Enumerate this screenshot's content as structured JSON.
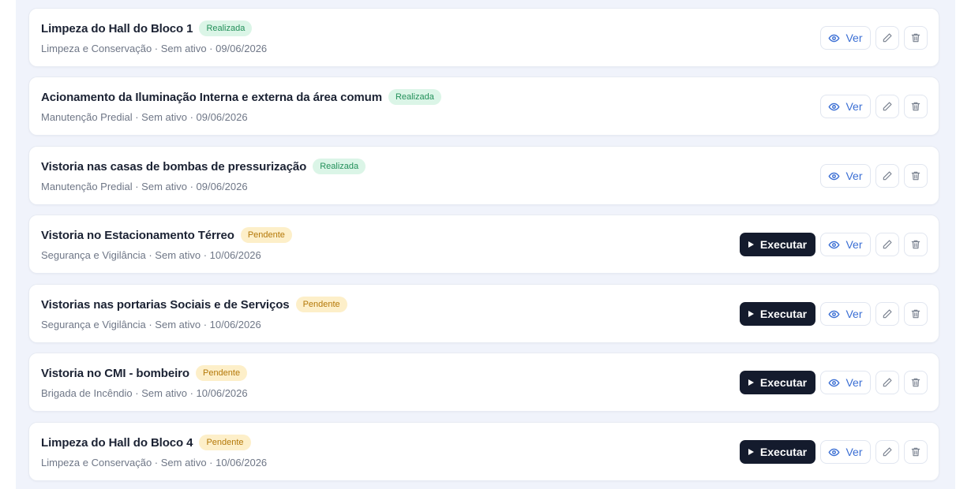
{
  "colors": {
    "background": "#f0f3fb",
    "card": "#ffffff",
    "done_badge_bg": "#dbf5e7",
    "done_badge_text": "#23905a",
    "pending_badge_bg": "#fdefc9",
    "pending_badge_text": "#b47808",
    "execute_button": "#141b2d",
    "link_blue": "#3b6fd4"
  },
  "icons": {
    "execute": "play-icon",
    "view": "eye-icon",
    "edit": "pencil-icon",
    "delete": "trash-icon"
  },
  "labels": {
    "execute": "Executar",
    "view": "Ver"
  },
  "tasks": [
    {
      "title": "Limpeza do Hall do Bloco 1",
      "status": "Realizada",
      "status_type": "done",
      "meta": "Limpeza e Conservação · Sem ativo · 09/06/2026",
      "can_execute": false
    },
    {
      "title": "Acionamento da Iluminação Interna e externa da área comum",
      "status": "Realizada",
      "status_type": "done",
      "meta": "Manutenção Predial · Sem ativo · 09/06/2026",
      "can_execute": false
    },
    {
      "title": "Vistoria nas casas de bombas de pressurização",
      "status": "Realizada",
      "status_type": "done",
      "meta": "Manutenção Predial · Sem ativo · 09/06/2026",
      "can_execute": false
    },
    {
      "title": "Vistoria no Estacionamento Térreo",
      "status": "Pendente",
      "status_type": "pending",
      "meta": "Segurança e Vigilância · Sem ativo · 10/06/2026",
      "can_execute": true
    },
    {
      "title": "Vistorias nas portarias Sociais e de Serviços",
      "status": "Pendente",
      "status_type": "pending",
      "meta": "Segurança e Vigilância · Sem ativo · 10/06/2026",
      "can_execute": true
    },
    {
      "title": "Vistoria no CMI - bombeiro",
      "status": "Pendente",
      "status_type": "pending",
      "meta": "Brigada de Incêndio · Sem ativo · 10/06/2026",
      "can_execute": true
    },
    {
      "title": "Limpeza do Hall do Bloco 4",
      "status": "Pendente",
      "status_type": "pending",
      "meta": "Limpeza e Conservação · Sem ativo · 10/06/2026",
      "can_execute": true
    }
  ]
}
